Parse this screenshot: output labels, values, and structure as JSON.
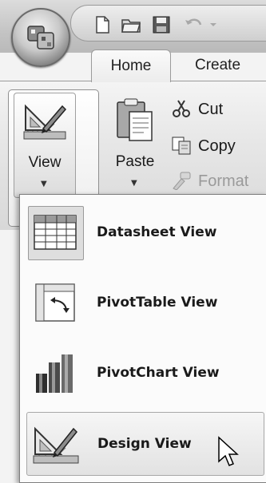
{
  "qat": {
    "icons": [
      "new-document-icon",
      "open-folder-icon",
      "save-icon",
      "undo-icon"
    ]
  },
  "tabs": {
    "home": "Home",
    "create": "Create"
  },
  "ribbon": {
    "view_button": {
      "label": "View",
      "icon": "design-view-icon"
    },
    "paste_button": {
      "label": "Paste",
      "icon": "clipboard-icon"
    },
    "clipboard_items": [
      {
        "label": "Cut",
        "icon": "scissors-icon",
        "enabled": true
      },
      {
        "label": "Copy",
        "icon": "copy-icon",
        "enabled": true
      },
      {
        "label": "Format",
        "icon": "format-painter-icon",
        "enabled": false
      }
    ]
  },
  "view_menu": {
    "items": [
      {
        "label": "Datasheet View",
        "icon": "datasheet-view-icon",
        "state": "selected"
      },
      {
        "label": "PivotTable View",
        "icon": "pivottable-view-icon",
        "state": "normal"
      },
      {
        "label": "PivotChart View",
        "icon": "pivotchart-view-icon",
        "state": "normal"
      },
      {
        "label": "Design View",
        "icon": "design-view-icon",
        "state": "hover"
      }
    ]
  },
  "colors": {
    "ribbon_bg": "#e7e7e7",
    "menu_bg": "#fbfbfb",
    "hover_bg": "#e2e2e2",
    "border": "#7e7e7e"
  }
}
